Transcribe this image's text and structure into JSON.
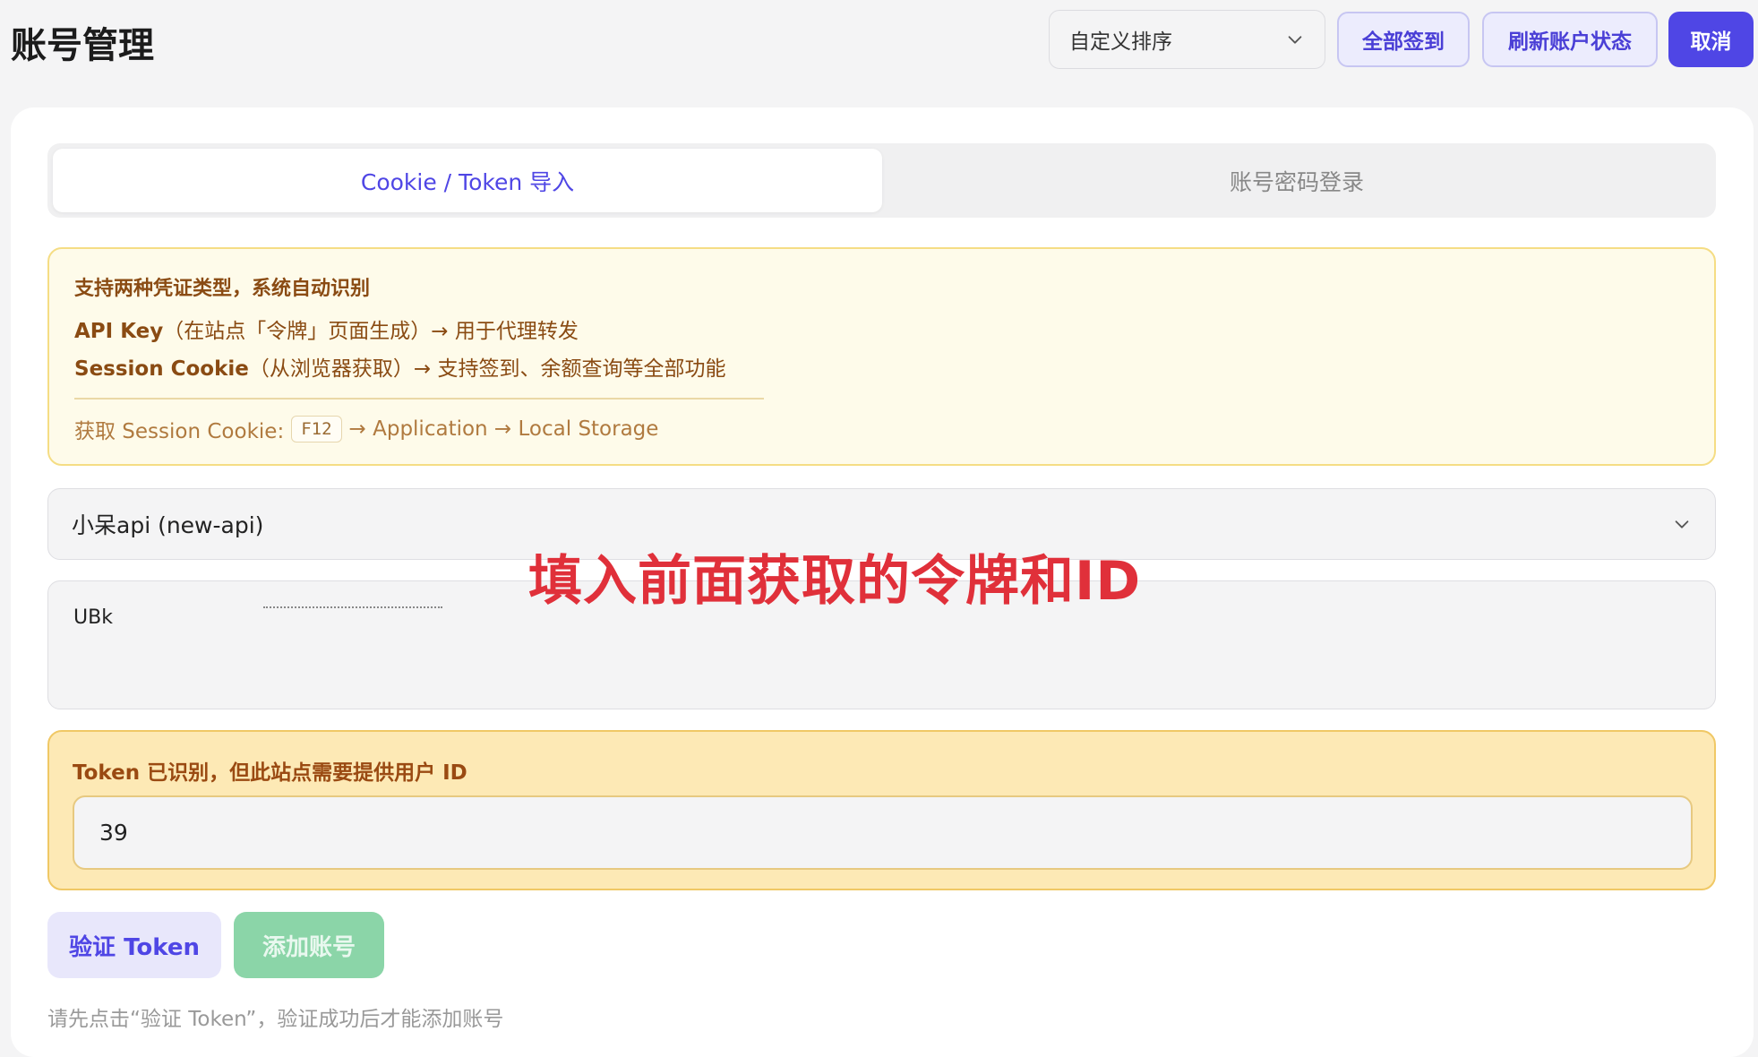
{
  "header": {
    "title": "账号管理",
    "sort_select_value": "自定义排序",
    "sign_all_label": "全部签到",
    "refresh_label": "刷新账户状态",
    "cancel_label": "取消"
  },
  "tabs": [
    {
      "label": "Cookie / Token 导入",
      "active": true
    },
    {
      "label": "账号密码登录",
      "active": false
    }
  ],
  "notice": {
    "title": "支持两种凭证类型，系统自动识别",
    "line1_strong": "API Key",
    "line1_rest": "（在站点「令牌」页面生成）→ 用于代理转发",
    "line2_strong": "Session Cookie",
    "line2_rest": "（从浏览器获取）→ 支持签到、余额查询等全部功能",
    "hint_prefix": "获取 Session Cookie:",
    "hint_key": "F12",
    "hint_suffix": "→ Application → Local Storage"
  },
  "site_select": {
    "value": "小呆api (new-api)"
  },
  "token_input": {
    "value": "UBk"
  },
  "annotation": {
    "text": "填入前面获取的令牌和ID",
    "color": "#e0303a"
  },
  "uid_panel": {
    "label": "Token 已识别，但此站点需要提供用户 ID",
    "value": "39"
  },
  "actions": {
    "verify_label": "验证 Token",
    "add_label": "添加账号"
  },
  "footnote": "请先点击“验证 Token”，验证成功后才能添加账号",
  "colors": {
    "accent": "#4f46e5",
    "warning_bg": "#fde9b5",
    "success_disabled": "#8bd5a8"
  }
}
